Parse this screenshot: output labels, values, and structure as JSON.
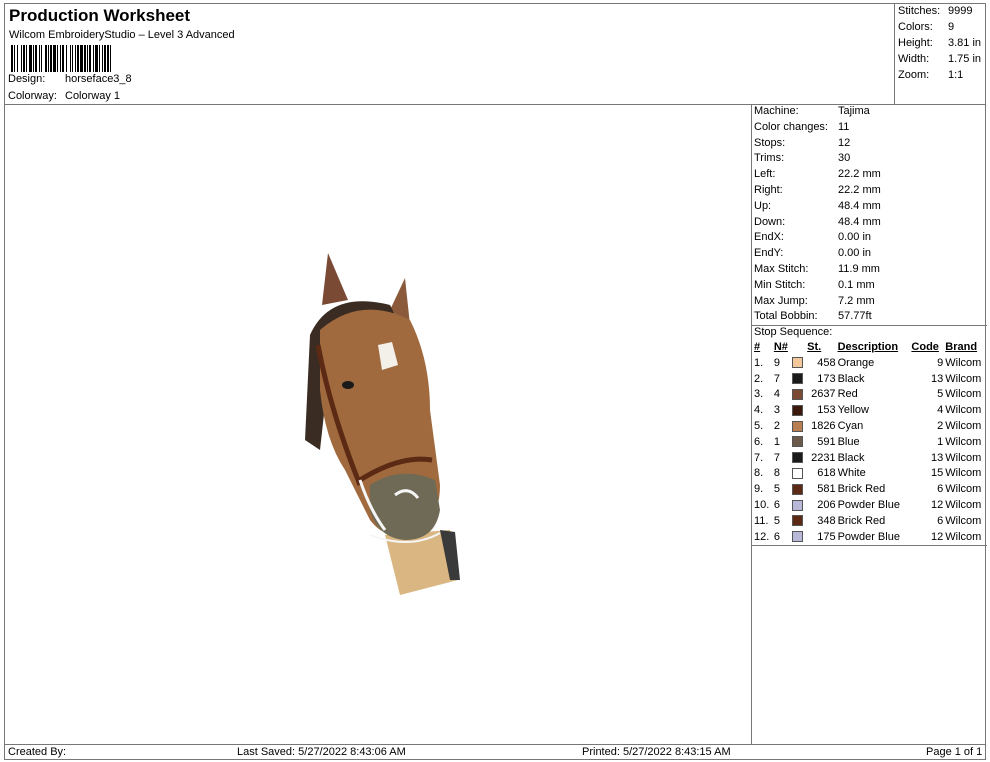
{
  "header": {
    "title": "Production Worksheet",
    "subtitle": "Wilcom EmbroideryStudio – Level 3 Advanced",
    "design_label": "Design:",
    "design_value": "horseface3_8",
    "colorway_label": "Colorway:",
    "colorway_value": "Colorway 1"
  },
  "summary": [
    {
      "label": "Stitches:",
      "value": "9999"
    },
    {
      "label": "Colors:",
      "value": "9"
    },
    {
      "label": "Height:",
      "value": "3.81 in"
    },
    {
      "label": "Width:",
      "value": "1.75 in"
    },
    {
      "label": "Zoom:",
      "value": "1:1"
    }
  ],
  "machine_info": [
    {
      "label": "Machine:",
      "value": "Tajima"
    },
    {
      "label": "Color changes:",
      "value": "11"
    },
    {
      "label": "Stops:",
      "value": "12"
    },
    {
      "label": "Trims:",
      "value": "30"
    },
    {
      "label": "Left:",
      "value": "22.2 mm"
    },
    {
      "label": "Right:",
      "value": "22.2 mm"
    },
    {
      "label": "Up:",
      "value": "48.4 mm"
    },
    {
      "label": "Down:",
      "value": "48.4 mm"
    },
    {
      "label": "EndX:",
      "value": "0.00 in"
    },
    {
      "label": "EndY:",
      "value": "0.00 in"
    },
    {
      "label": "Max Stitch:",
      "value": "11.9 mm"
    },
    {
      "label": "Min Stitch:",
      "value": "0.1 mm"
    },
    {
      "label": "Max Jump:",
      "value": "7.2 mm"
    },
    {
      "label": "Total Bobbin:",
      "value": "57.77ft"
    }
  ],
  "stop_sequence": {
    "title": "Stop Sequence:",
    "headers": {
      "num": "#",
      "n": "N#",
      "st": "St.",
      "description": "Description",
      "code": "Code",
      "brand": "Brand"
    },
    "rows": [
      {
        "num": "1.",
        "n": "9",
        "color": "#f2c79a",
        "st": "458",
        "description": "Orange",
        "code": "9",
        "brand": "Wilcom"
      },
      {
        "num": "2.",
        "n": "7",
        "color": "#1a1a1a",
        "st": "173",
        "description": "Black",
        "code": "13",
        "brand": "Wilcom"
      },
      {
        "num": "3.",
        "n": "4",
        "color": "#7a4a35",
        "st": "2637",
        "description": "Red",
        "code": "5",
        "brand": "Wilcom"
      },
      {
        "num": "4.",
        "n": "3",
        "color": "#3b1a0e",
        "st": "153",
        "description": "Yellow",
        "code": "4",
        "brand": "Wilcom"
      },
      {
        "num": "5.",
        "n": "2",
        "color": "#b97f52",
        "st": "1826",
        "description": "Cyan",
        "code": "2",
        "brand": "Wilcom"
      },
      {
        "num": "6.",
        "n": "1",
        "color": "#6b5a4a",
        "st": "591",
        "description": "Blue",
        "code": "1",
        "brand": "Wilcom"
      },
      {
        "num": "7.",
        "n": "7",
        "color": "#1a1a1a",
        "st": "2231",
        "description": "Black",
        "code": "13",
        "brand": "Wilcom"
      },
      {
        "num": "8.",
        "n": "8",
        "color": "#ffffff",
        "st": "618",
        "description": "White",
        "code": "15",
        "brand": "Wilcom"
      },
      {
        "num": "9.",
        "n": "5",
        "color": "#5c2a14",
        "st": "581",
        "description": "Brick Red",
        "code": "6",
        "brand": "Wilcom"
      },
      {
        "num": "10.",
        "n": "6",
        "color": "#b8b8d8",
        "st": "206",
        "description": "Powder Blue",
        "code": "12",
        "brand": "Wilcom"
      },
      {
        "num": "11.",
        "n": "5",
        "color": "#5c2a14",
        "st": "348",
        "description": "Brick Red",
        "code": "6",
        "brand": "Wilcom"
      },
      {
        "num": "12.",
        "n": "6",
        "color": "#b8b8d8",
        "st": "175",
        "description": "Powder Blue",
        "code": "12",
        "brand": "Wilcom"
      }
    ]
  },
  "footer": {
    "created_by": "Created By:",
    "last_saved": "Last Saved: 5/27/2022 8:43:06 AM",
    "printed": "Printed: 5/27/2022 8:43:15 AM",
    "page": "Page 1 of 1"
  }
}
